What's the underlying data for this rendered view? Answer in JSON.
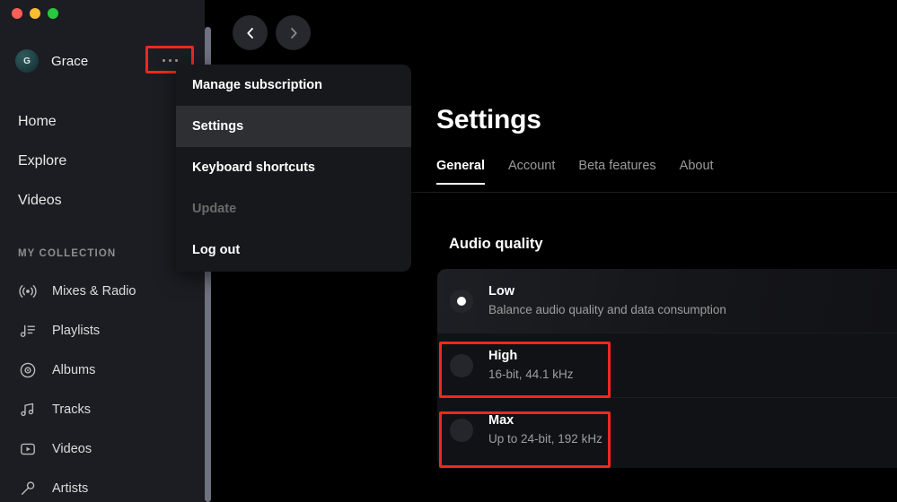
{
  "window": {
    "traffic_lights": [
      {
        "name": "close",
        "color": "#ff5f57"
      },
      {
        "name": "minimize",
        "color": "#febc2e"
      },
      {
        "name": "maximize",
        "color": "#28c840"
      }
    ]
  },
  "sidebar": {
    "profile": {
      "name": "Grace",
      "avatar_initial": "G"
    },
    "more_button_label": "more-options",
    "nav": [
      {
        "label": "Home"
      },
      {
        "label": "Explore"
      },
      {
        "label": "Videos"
      }
    ],
    "collection_title": "MY COLLECTION",
    "collection": [
      {
        "label": "Mixes & Radio",
        "icon": "broadcast-icon"
      },
      {
        "label": "Playlists",
        "icon": "playlist-icon"
      },
      {
        "label": "Albums",
        "icon": "album-disc-icon"
      },
      {
        "label": "Tracks",
        "icon": "music-note-icon"
      },
      {
        "label": "Videos",
        "icon": "video-play-icon"
      },
      {
        "label": "Artists",
        "icon": "microphone-icon"
      }
    ]
  },
  "toolbar": {
    "back_label": "Back",
    "forward_label": "Forward"
  },
  "menu": {
    "items": [
      {
        "label": "Manage subscription",
        "state": "normal"
      },
      {
        "label": "Settings",
        "state": "highlighted"
      },
      {
        "label": "Keyboard shortcuts",
        "state": "normal"
      },
      {
        "label": "Update",
        "state": "disabled"
      },
      {
        "label": "Log out",
        "state": "normal"
      }
    ]
  },
  "main": {
    "title": "Settings",
    "tabs": [
      {
        "label": "General",
        "active": true
      },
      {
        "label": "Account",
        "active": false
      },
      {
        "label": "Beta features",
        "active": false
      },
      {
        "label": "About",
        "active": false
      }
    ],
    "section_title": "Audio quality",
    "options": [
      {
        "label": "Low",
        "sub": "Balance audio quality and data consumption",
        "selected": true,
        "highlighted": false
      },
      {
        "label": "High",
        "sub": "16-bit, 44.1 kHz",
        "selected": false,
        "highlighted": true
      },
      {
        "label": "Max",
        "sub": "Up to 24-bit, 192 kHz",
        "selected": false,
        "highlighted": true
      }
    ]
  },
  "annotations": {
    "color": "#f0281e",
    "boxes": [
      "more-options-button",
      "high-quality-option",
      "max-quality-option"
    ]
  }
}
